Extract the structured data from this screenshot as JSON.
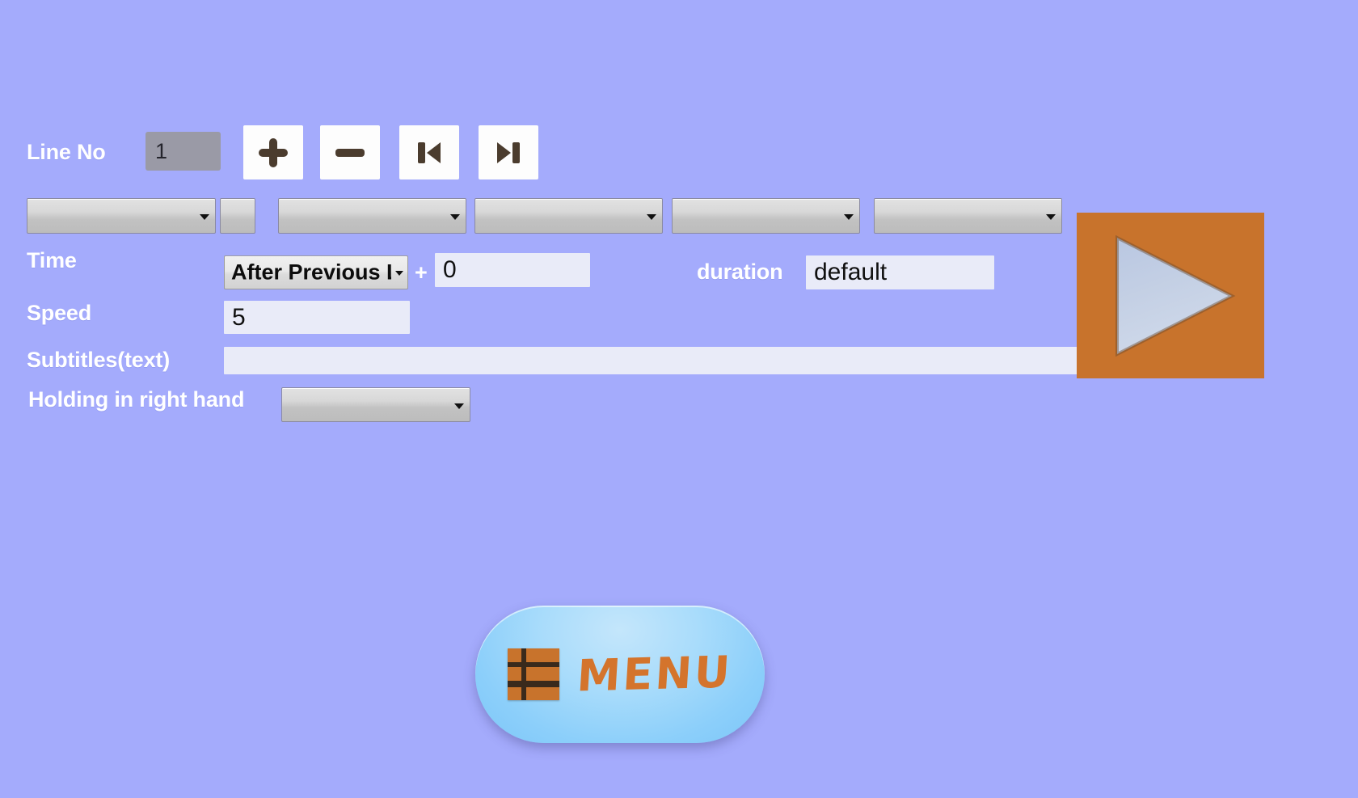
{
  "app": {
    "background_color": "#a4abfc",
    "accent_orange": "#c8732c",
    "label_color": "#ffffff"
  },
  "line_row": {
    "label": "Line No",
    "value": "1",
    "buttons": [
      {
        "name": "add-line-button",
        "icon": "plus-icon"
      },
      {
        "name": "remove-line-button",
        "icon": "minus-icon"
      },
      {
        "name": "previous-line-button",
        "icon": "skip-previous-icon"
      },
      {
        "name": "next-line-button",
        "icon": "skip-next-icon"
      }
    ]
  },
  "selector_row": {
    "dropdowns": [
      {
        "name": "character-select",
        "value": ""
      },
      {
        "name": "modifier-field",
        "value": ""
      },
      {
        "name": "action-select",
        "value": ""
      },
      {
        "name": "target-select",
        "value": ""
      },
      {
        "name": "manner-select",
        "value": ""
      },
      {
        "name": "extra-select",
        "value": ""
      }
    ]
  },
  "time_row": {
    "label": "Time",
    "trigger": "After Previous L",
    "plus": "+",
    "offset": "0",
    "duration_label": "duration",
    "duration_value": "default"
  },
  "speed_row": {
    "label": "Speed",
    "value": "5"
  },
  "subtitles_row": {
    "label": "Subtitles(text)",
    "value": "",
    "placeholder": ""
  },
  "holding_row": {
    "label": "Holding in right hand",
    "value": ""
  },
  "preview": {
    "name": "play-preview-button",
    "icon": "play-icon"
  },
  "menu": {
    "label": "MENU",
    "icon": "menu-grid-icon"
  }
}
